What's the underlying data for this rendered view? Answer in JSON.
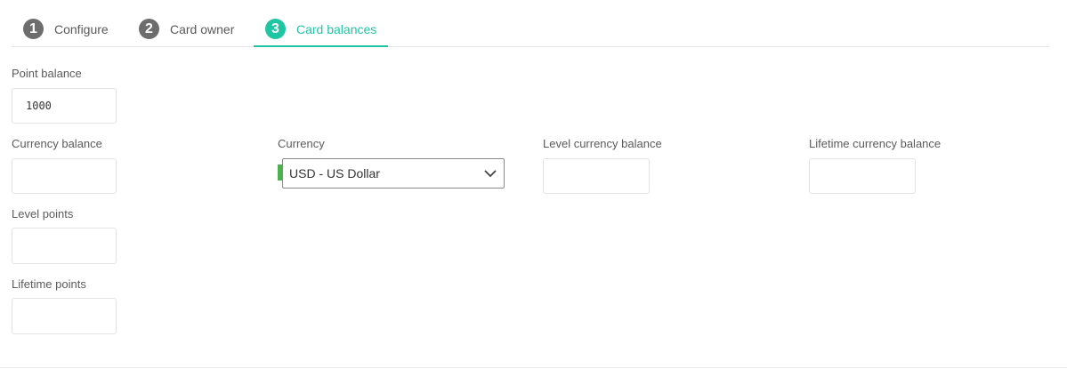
{
  "steps": [
    {
      "number": "1",
      "label": "Configure"
    },
    {
      "number": "2",
      "label": "Card owner"
    },
    {
      "number": "3",
      "label": "Card balances"
    }
  ],
  "active_step": 3,
  "fields": {
    "point_balance": {
      "label": "Point balance",
      "value": "1000"
    },
    "currency_balance": {
      "label": "Currency balance",
      "value": ""
    },
    "currency": {
      "label": "Currency",
      "value": "USD - US Dollar"
    },
    "level_currency_balance": {
      "label": "Level currency balance",
      "value": ""
    },
    "lifetime_currency_balance": {
      "label": "Lifetime currency balance",
      "value": ""
    },
    "level_points": {
      "label": "Level points",
      "value": ""
    },
    "lifetime_points": {
      "label": "Lifetime points",
      "value": ""
    }
  },
  "colors": {
    "accent": "#1fc6a3",
    "inactive_step": "#6d6d6d",
    "required_marker": "#4caf50"
  },
  "icons": {
    "currency_select": "chevron-down-icon"
  }
}
